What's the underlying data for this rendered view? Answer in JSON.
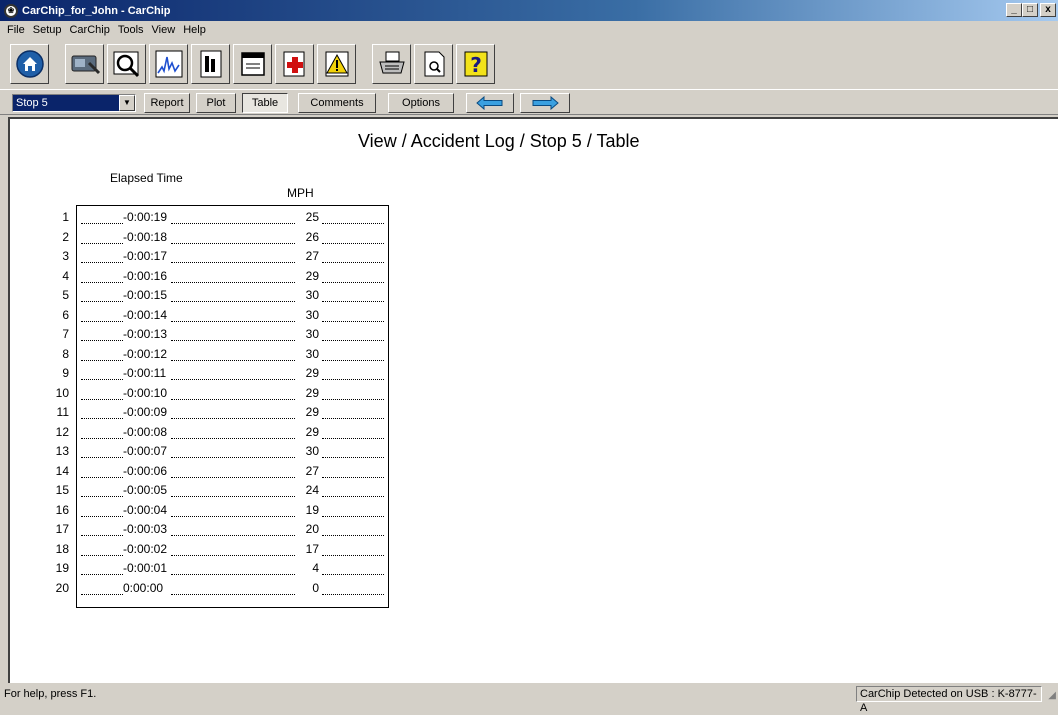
{
  "window": {
    "title": "CarChip_for_John - CarChip",
    "minimize": "_",
    "maximize": "□",
    "close": "x"
  },
  "menu": [
    "File",
    "Setup",
    "CarChip",
    "Tools",
    "View",
    "Help"
  ],
  "toolbar_icons": [
    "home-icon",
    "download-icon",
    "view-icon",
    "graph-icon",
    "report-icon",
    "window-icon",
    "first-aid-icon",
    "warning-icon",
    "print-icon",
    "print-preview-icon",
    "help-icon"
  ],
  "nav": {
    "stop_select": "Stop 5",
    "report": "Report",
    "plot": "Plot",
    "table": "Table",
    "comments": "Comments",
    "options": "Options"
  },
  "view_title": "View / Accident Log / Stop 5 / Table",
  "columns": {
    "elapsed_time": "Elapsed Time",
    "mph": "MPH"
  },
  "rows": [
    {
      "n": "1",
      "time": "-0:00:19",
      "mph": "25"
    },
    {
      "n": "2",
      "time": "-0:00:18",
      "mph": "26"
    },
    {
      "n": "3",
      "time": "-0:00:17",
      "mph": "27"
    },
    {
      "n": "4",
      "time": "-0:00:16",
      "mph": "29"
    },
    {
      "n": "5",
      "time": "-0:00:15",
      "mph": "30"
    },
    {
      "n": "6",
      "time": "-0:00:14",
      "mph": "30"
    },
    {
      "n": "7",
      "time": "-0:00:13",
      "mph": "30"
    },
    {
      "n": "8",
      "time": "-0:00:12",
      "mph": "30"
    },
    {
      "n": "9",
      "time": "-0:00:11",
      "mph": "29"
    },
    {
      "n": "10",
      "time": "-0:00:10",
      "mph": "29"
    },
    {
      "n": "11",
      "time": "-0:00:09",
      "mph": "29"
    },
    {
      "n": "12",
      "time": "-0:00:08",
      "mph": "29"
    },
    {
      "n": "13",
      "time": "-0:00:07",
      "mph": "30"
    },
    {
      "n": "14",
      "time": "-0:00:06",
      "mph": "27"
    },
    {
      "n": "15",
      "time": "-0:00:05",
      "mph": "24"
    },
    {
      "n": "16",
      "time": "-0:00:04",
      "mph": "19"
    },
    {
      "n": "17",
      "time": "-0:00:03",
      "mph": "20"
    },
    {
      "n": "18",
      "time": "-0:00:02",
      "mph": "17"
    },
    {
      "n": "19",
      "time": "-0:00:01",
      "mph": "4"
    },
    {
      "n": "20",
      "time": "0:00:00",
      "mph": "0"
    }
  ],
  "status": {
    "help": "For help, press F1.",
    "device": "CarChip Detected on USB : K-8777-A"
  }
}
